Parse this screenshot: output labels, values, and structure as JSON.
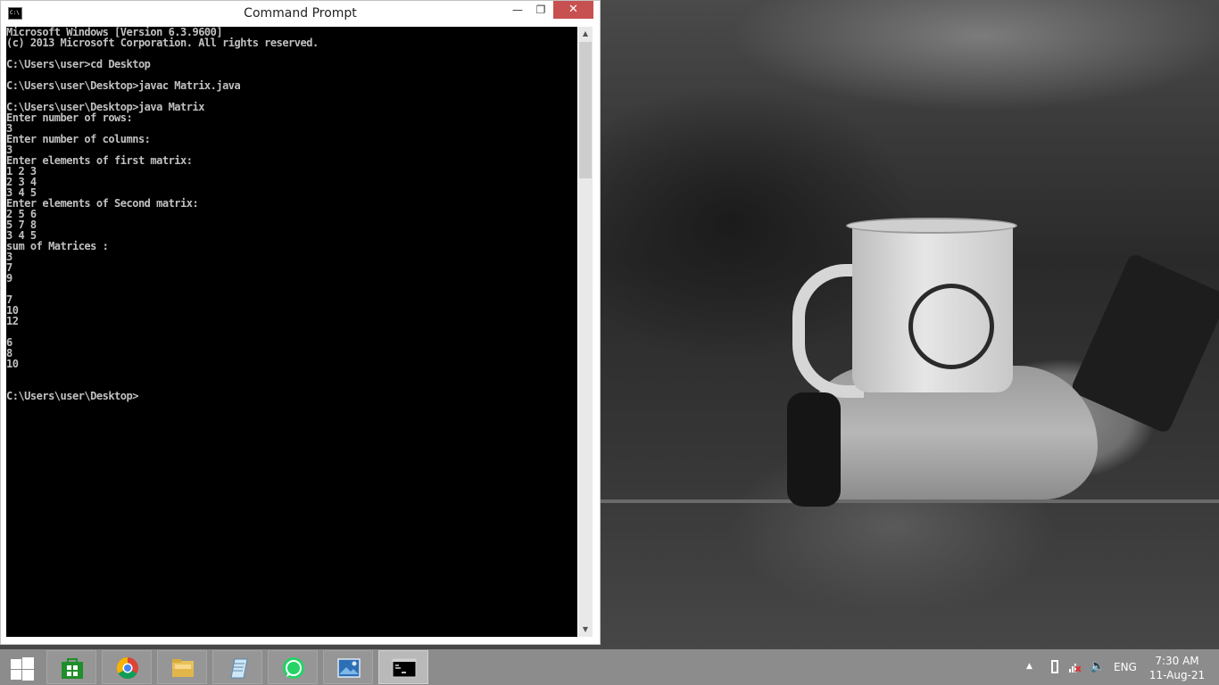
{
  "window": {
    "title": "Command Prompt",
    "icon_text": "C:\\",
    "minimize_symbol": "—",
    "maximize_symbol": "❐",
    "close_symbol": "✕"
  },
  "console": {
    "lines": [
      "Microsoft Windows [Version 6.3.9600]",
      "(c) 2013 Microsoft Corporation. All rights reserved.",
      "",
      "C:\\Users\\user>cd Desktop",
      "",
      "C:\\Users\\user\\Desktop>javac Matrix.java",
      "",
      "C:\\Users\\user\\Desktop>java Matrix",
      "Enter number of rows:",
      "3",
      "Enter number of columns:",
      "3",
      "Enter elements of first matrix:",
      "1 2 3",
      "2 3 4",
      "3 4 5",
      "Enter elements of Second matrix:",
      "2 5 6",
      "5 7 8",
      "3 4 5",
      "sum of Matrices :",
      "3",
      "7",
      "9",
      "",
      "7",
      "10",
      "12",
      "",
      "6",
      "8",
      "10",
      "",
      "",
      "C:\\Users\\user\\Desktop>"
    ]
  },
  "scrollbar": {
    "up_symbol": "▲",
    "down_symbol": "▼"
  },
  "taskbar": {
    "apps": [
      {
        "name": "store",
        "icon": "store-icon"
      },
      {
        "name": "chrome",
        "icon": "chrome-icon"
      },
      {
        "name": "file-explorer",
        "icon": "folder-icon"
      },
      {
        "name": "notepad",
        "icon": "notepad-icon"
      },
      {
        "name": "whatsapp",
        "icon": "whatsapp-icon"
      },
      {
        "name": "photos",
        "icon": "photos-icon"
      },
      {
        "name": "command-prompt",
        "icon": "terminal-icon",
        "active": true
      }
    ],
    "tray": {
      "overflow_symbol": "▲",
      "language": "ENG",
      "time": "7:30 AM",
      "date": "11-Aug-21"
    }
  },
  "colors": {
    "console_bg": "#000000",
    "console_fg": "#c0c0c0",
    "close_button": "#c75050",
    "taskbar": "#8c8c8c"
  }
}
